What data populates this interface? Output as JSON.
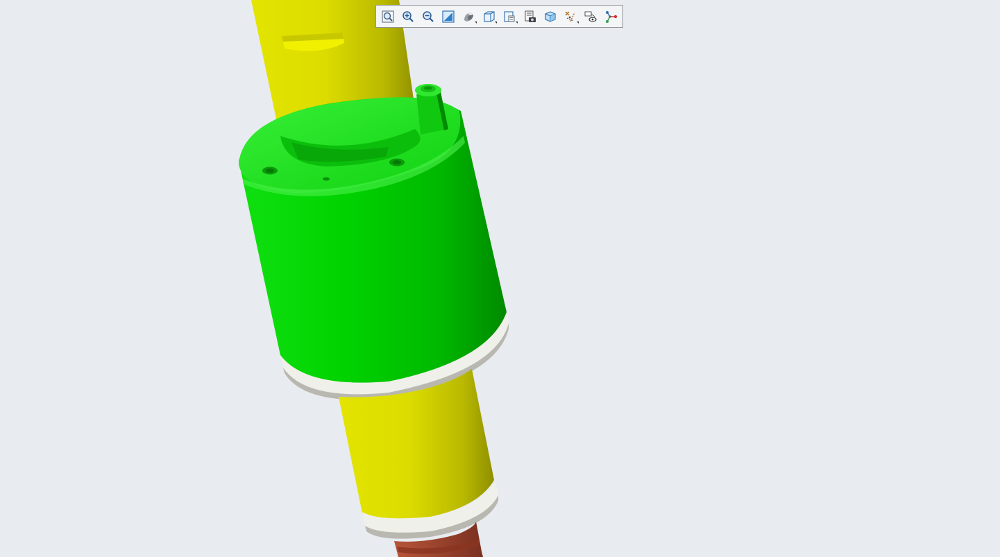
{
  "toolbar": {
    "buttons": [
      {
        "icon": "refit-view-icon",
        "has_dropdown": false
      },
      {
        "icon": "zoom-in-icon",
        "has_dropdown": false
      },
      {
        "icon": "zoom-out-icon",
        "has_dropdown": false
      },
      {
        "icon": "repaint-icon",
        "has_dropdown": false
      },
      {
        "icon": "display-style-icon",
        "has_dropdown": true
      },
      {
        "icon": "saved-orientations-icon",
        "has_dropdown": true
      },
      {
        "icon": "view-manager-icon",
        "has_dropdown": true
      },
      {
        "icon": "appearance-gallery-icon",
        "has_dropdown": false
      },
      {
        "icon": "perspective-view-icon",
        "has_dropdown": false
      },
      {
        "icon": "datum-display-filters-icon",
        "has_dropdown": true
      },
      {
        "icon": "annotation-display-icon",
        "has_dropdown": false
      },
      {
        "icon": "spin-center-icon",
        "has_dropdown": false
      }
    ]
  },
  "model": {
    "parts": [
      {
        "name": "upper-shaft",
        "color": "#dede00"
      },
      {
        "name": "green-housing",
        "color": "#00cc00"
      },
      {
        "name": "white-ring",
        "color": "#f0f0ea"
      },
      {
        "name": "lower-shaft",
        "color": "#dede00"
      },
      {
        "name": "bottom-white-ring",
        "color": "#f0f0ea"
      },
      {
        "name": "bottom-brown-part",
        "color": "#a0452e"
      }
    ],
    "background": "#e8ebef"
  }
}
